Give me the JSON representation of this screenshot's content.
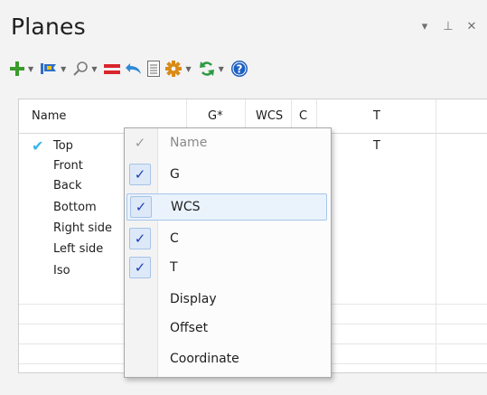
{
  "panel": {
    "title": "Planes",
    "controls": {
      "menu": "▾",
      "pin": "⊥",
      "close": "✕"
    }
  },
  "toolbar": {
    "icons": [
      "add-plane-icon",
      "flag-plane-icon",
      "search-icon",
      "equals-icon",
      "undo-icon",
      "document-icon",
      "gear-icon",
      "sync-icon",
      "help-icon"
    ],
    "colors": {
      "add": "#3a9b2c",
      "flag": "#2f6fc9",
      "equals": "#d9262c",
      "gear": "#d98b17",
      "sync": "#2e9a41",
      "help": "#1d5fc0"
    }
  },
  "grid": {
    "columns": [
      "Name",
      "G*",
      "WCS",
      "C",
      "T"
    ],
    "rows": [
      {
        "name": "Top",
        "checked": true,
        "t": "T"
      },
      {
        "name": "Front",
        "checked": false,
        "t": ""
      },
      {
        "name": "Back",
        "checked": false,
        "t": ""
      },
      {
        "name": "Bottom",
        "checked": false,
        "t": ""
      },
      {
        "name": "Right side",
        "checked": false,
        "t": ""
      },
      {
        "name": "Left side",
        "checked": false,
        "t": ""
      },
      {
        "name": "Iso",
        "checked": false,
        "t": ""
      }
    ],
    "check_glyph": "✔"
  },
  "context_menu": {
    "items": [
      {
        "label": "Name",
        "checked": true,
        "disabled": true
      },
      {
        "label": "G",
        "checked": true,
        "disabled": false
      },
      {
        "label": "WCS",
        "checked": true,
        "disabled": false,
        "highlighted": true
      },
      {
        "label": "C",
        "checked": true,
        "disabled": false
      },
      {
        "label": "T",
        "checked": true,
        "disabled": false
      },
      {
        "label": "Display",
        "checked": false,
        "disabled": false
      },
      {
        "label": "Offset",
        "checked": false,
        "disabled": false
      },
      {
        "label": "Coordinate",
        "checked": false,
        "disabled": false
      }
    ],
    "check_glyph": "✓"
  }
}
